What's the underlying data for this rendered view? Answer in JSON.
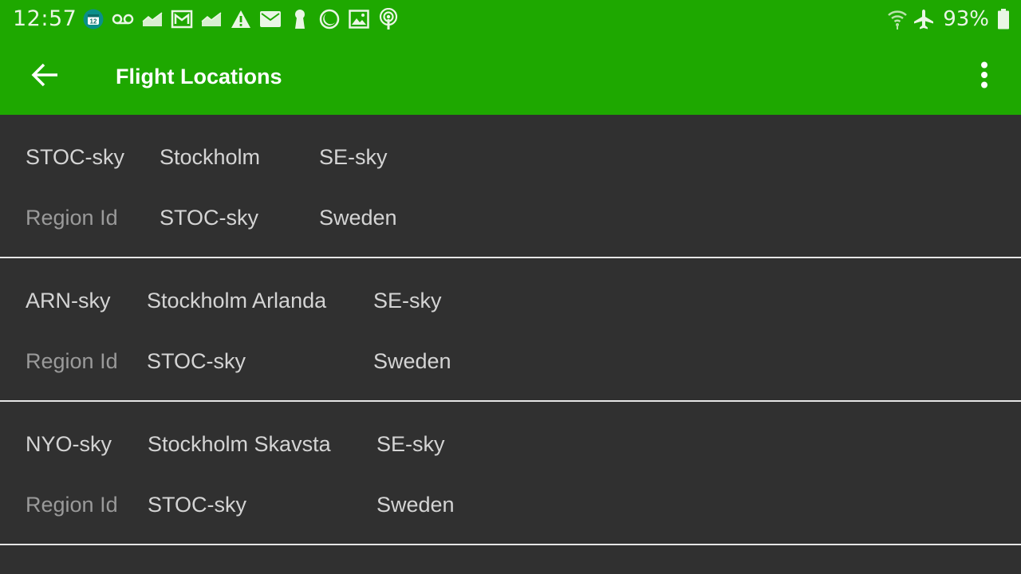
{
  "status_bar": {
    "time": "12:57",
    "calendar_day": "12",
    "battery_percent": "93%",
    "left_icons": [
      "calendar-icon",
      "voicemail-icon",
      "stock-chart-icon",
      "gmail-icon",
      "stock-chart-icon",
      "warning-icon",
      "email-icon",
      "keyhole-icon",
      "moon-icon",
      "image-icon",
      "podcast-icon"
    ],
    "right_icons": [
      "wifi-icon",
      "airplane-mode-icon",
      "battery-icon"
    ]
  },
  "colors": {
    "accent": "#1ea800",
    "background": "#303030",
    "divider": "#e6e6e6",
    "primary_text": "#d4d4d4",
    "secondary_text": "#9a9a9a"
  },
  "app_bar": {
    "title": "Flight Locations",
    "back_icon": "arrow-back-icon",
    "menu_icon": "more-vert-icon"
  },
  "locations": [
    {
      "code": "STOC-sky",
      "name": "Stockholm",
      "country_code": "SE-sky",
      "region_label": "Region Id",
      "region_id": "STOC-sky",
      "country": "Sweden"
    },
    {
      "code": "ARN-sky",
      "name": "Stockholm Arlanda",
      "country_code": "SE-sky",
      "region_label": "Region Id",
      "region_id": "STOC-sky",
      "country": "Sweden"
    },
    {
      "code": "NYO-sky",
      "name": "Stockholm Skavsta",
      "country_code": "SE-sky",
      "region_label": "Region Id",
      "region_id": "STOC-sky",
      "country": "Sweden"
    }
  ]
}
